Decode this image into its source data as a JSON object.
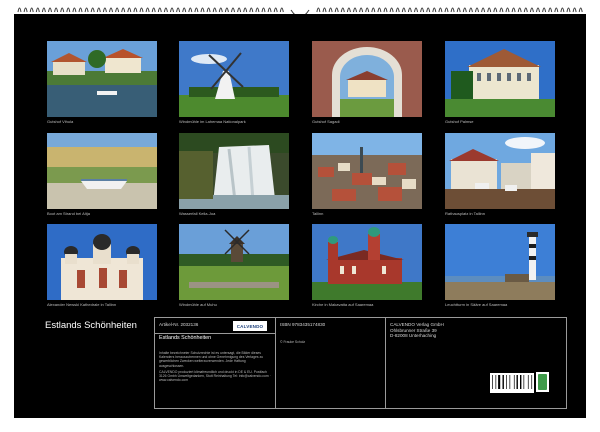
{
  "calendar": {
    "title": "Estlands Schönheiten",
    "photos": [
      {
        "caption": "Gutshof Vihula",
        "icon": "manor-pond-photo"
      },
      {
        "caption": "Windmühle im Lahemaa Nationalpark",
        "icon": "windmill-photo"
      },
      {
        "caption": "Gutshof Sagadi",
        "icon": "gate-manor-photo"
      },
      {
        "caption": "Gutshof Palmse",
        "icon": "palmse-manor-photo"
      },
      {
        "caption": "Boot am Strand bei Altja",
        "icon": "boat-beach-photo"
      },
      {
        "caption": "Wasserfall Keila-Joa",
        "icon": "waterfall-photo"
      },
      {
        "caption": "Tallinn",
        "icon": "tallinn-oldtown-photo"
      },
      {
        "caption": "Rathausplatz in Tallinn",
        "icon": "town-square-photo"
      },
      {
        "caption": "Alexander Newski Kathedrale in Tallinn",
        "icon": "cathedral-photo"
      },
      {
        "caption": "Windmühle auf Muhu",
        "icon": "muhu-windmill-photo"
      },
      {
        "caption": "Kirche in Makavatta auf Saaremaa",
        "icon": "church-photo"
      },
      {
        "caption": "Leuchtturm in Sääre auf Saaremaa",
        "icon": "lighthouse-photo"
      }
    ]
  },
  "info": {
    "article_number": "Artikel-Nr. 2032136",
    "logo_text": "CALVENDO",
    "subtitle": "Estlands Schönheiten",
    "description": "Inhalte bezeichneter Schutzrechte ist es untersagt, die Bilder dieses Kalenders herauszutrennen und ohne Genehmigung des Verlages zu gewerblichen Zwecken weiterzuverwenden. Jede Haftung ausgeschlossen.",
    "address_note": "CALVENDO produziert klimafreundlich und druckt in DE & EU. Postfach 3126 Gmbh Umweltgedanken, Stutt Reinhaltung Tel: info@calvendo.com · www.calvendo.com",
    "isbn": "ISBN 9783435174830",
    "copyright": "© Frauke Scholz",
    "publisher_lines": [
      "CALVENDO Verlag GmbH",
      "Ohlsbrunner Straße 39",
      "D-82008 Unterhaching"
    ]
  }
}
